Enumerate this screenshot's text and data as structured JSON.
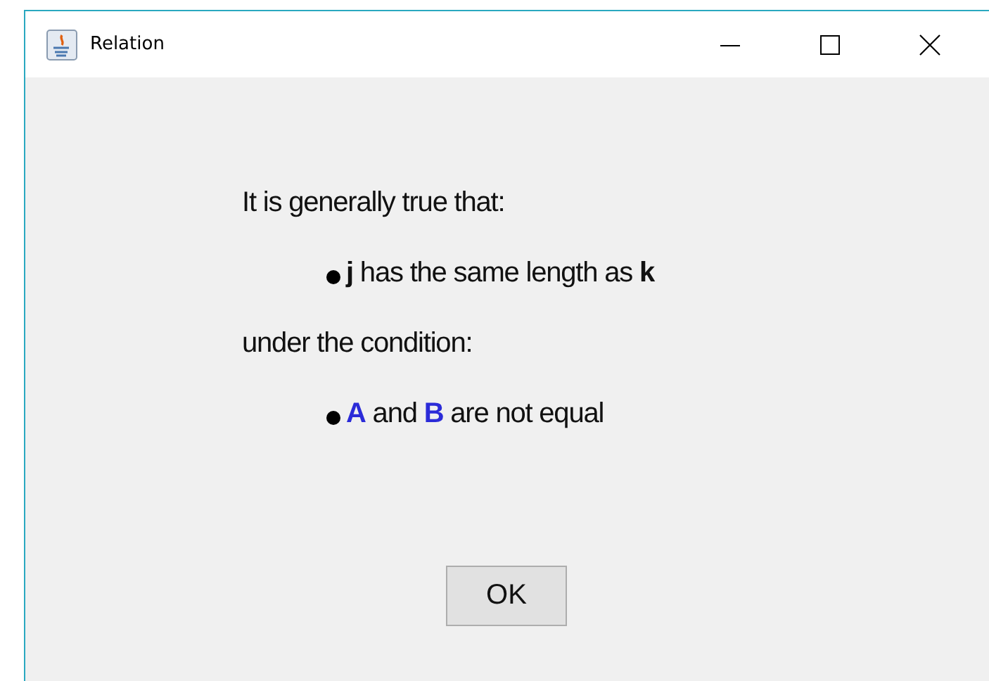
{
  "window": {
    "title": "Relation"
  },
  "content": [
    {
      "kind": "line",
      "segments": [
        {
          "text": "It is generally true that:",
          "kind": "plain"
        }
      ]
    },
    {
      "kind": "bullet",
      "segments": [
        {
          "text": "j",
          "kind": "bold"
        },
        {
          "text": " has the same length as ",
          "kind": "plain"
        },
        {
          "text": "k",
          "kind": "bold"
        }
      ]
    },
    {
      "kind": "line",
      "segments": [
        {
          "text": "under the condition:",
          "kind": "plain"
        }
      ]
    },
    {
      "kind": "bullet",
      "segments": [
        {
          "text": "A",
          "kind": "term"
        },
        {
          "text": " and ",
          "kind": "plain"
        },
        {
          "text": "B",
          "kind": "term"
        },
        {
          "text": " are not equal",
          "kind": "plain"
        }
      ]
    }
  ],
  "buttons": [
    "OK"
  ]
}
